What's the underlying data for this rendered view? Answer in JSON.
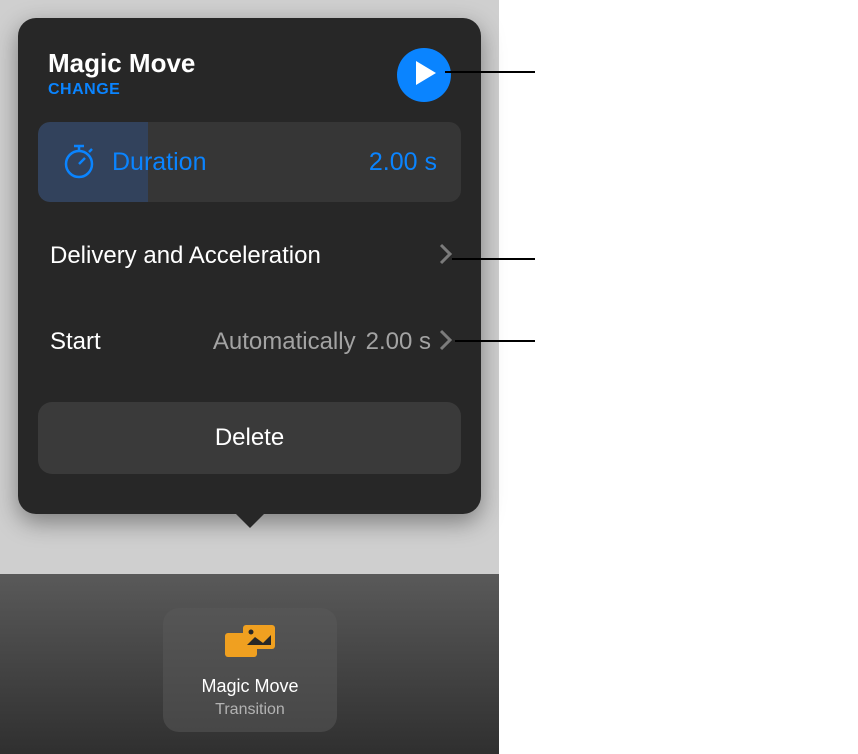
{
  "popover": {
    "title": "Magic Move",
    "change_label": "CHANGE",
    "duration": {
      "label": "Duration",
      "value": "2.00 s"
    },
    "delivery": {
      "label": "Delivery and Acceleration"
    },
    "start": {
      "label": "Start",
      "mode": "Automatically",
      "time": "2.00 s"
    },
    "delete_label": "Delete"
  },
  "transition_chip": {
    "name": "Magic Move",
    "sublabel": "Transition"
  },
  "colors": {
    "accent": "#0a84ff",
    "transition_icon": "#f0a020"
  }
}
